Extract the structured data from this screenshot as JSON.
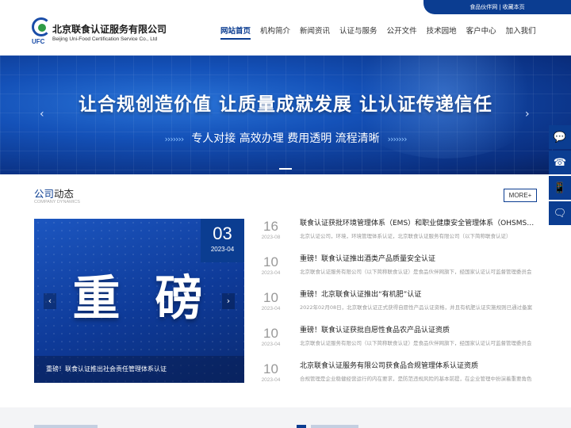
{
  "top_links": {
    "partner": "食品伙伴网",
    "divider": "|",
    "bookmark": "收藏本页"
  },
  "logo": {
    "mark_text": "UFC",
    "name_cn": "北京联食认证服务有限公司",
    "name_en": "Beijing Uni-Food Certification Service Co., Ltd"
  },
  "nav": [
    {
      "label": "网站首页",
      "active": true
    },
    {
      "label": "机构简介"
    },
    {
      "label": "新闻资讯"
    },
    {
      "label": "认证与服务"
    },
    {
      "label": "公开文件"
    },
    {
      "label": "技术园地"
    },
    {
      "label": "客户中心"
    },
    {
      "label": "加入我们"
    }
  ],
  "banner": {
    "slogan": "让合规创造价值 让质量成就发展 让认证传递信任",
    "subtitle": "专人对接 高效办理 费用透明 流程清晰",
    "prev_arrow": "‹",
    "next_arrow": "›"
  },
  "section": {
    "title_highlight": "公司",
    "title_rest": "动态",
    "subtitle": "COMPANY DYNAMICS",
    "more_label": "MORE+"
  },
  "feature": {
    "big_text": "重磅",
    "day": "03",
    "year_month": "2023-04",
    "caption": "重磅！联食认证推出社会责任管理体系认证",
    "prev_arrow": "‹",
    "next_arrow": "›"
  },
  "news": [
    {
      "day": "16",
      "ym": "2023-08",
      "title": "联食认证获批环境管理体系（EMS）和职业健康安全管理体系（OHSMS）认证资质",
      "desc": "北京认证公司，环境，环境管理体系认证，北京联食认证服务有限公司（以下简称联食认证）"
    },
    {
      "day": "10",
      "ym": "2023-04",
      "title": "重磅！联食认证推出酒类产品质量安全认证",
      "desc": "北京联食认证服务有限公司（以下简称联食认证）是食品伙伴网旗下，经国家认证认可监督管理委员会"
    },
    {
      "day": "10",
      "ym": "2023-04",
      "title": "重磅！北京联食认证推出“有机肥”认证",
      "desc": "2022年02月08日，北京联食认证正式获得自愿性产品认证资格，并且有机肥认证实施规则已通过备案"
    },
    {
      "day": "10",
      "ym": "2023-04",
      "title": "重磅！联食认证获批自愿性食品农产品认证资质",
      "desc": "北京联食认证服务有限公司（以下简称联食认证）是食品伙伴网旗下，经国家认证认可监督管理委员会"
    },
    {
      "day": "10",
      "ym": "2023-04",
      "title": "北京联食认证服务有限公司获食品合规管理体系认证资质",
      "desc": "合规管理是企业稳健经营运行的内在要求，是防范违规风险的基本前提，在企业管理中扮演着重要角色"
    }
  ],
  "float_icons": [
    "chat-icon",
    "phone-icon",
    "mobile-icon",
    "wechat-icon"
  ],
  "float_glyphs": [
    "💬",
    "☎",
    "📱",
    "🗨"
  ],
  "colors": {
    "brand": "#0b3d91",
    "accent": "#1a4da8"
  }
}
